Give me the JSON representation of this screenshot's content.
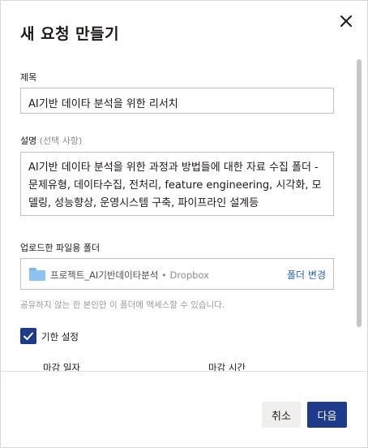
{
  "dialog": {
    "title": "새 요청 만들기",
    "close_icon": "close-icon"
  },
  "form": {
    "title_label": "제목",
    "title_value": "AI기반 데이타 분석을 위한 리서치",
    "description_label": "설명",
    "description_optional": "(선택 사항)",
    "description_value": "AI기반 데이타 분석을 위한 과정과 방법들에 대한 자료 수집 폴더 - 문제유형, 데이타수집, 전처리, feature engineering, 시각화, 모델링, 성능향상, 운영시스템 구축, 파이프라인 설계등",
    "folder_label": "업로드한 파일용 폴더",
    "folder_name": "프로젝트_AI기반데이타분석",
    "folder_source": " • Dropbox",
    "change_folder": "폴더 변경",
    "helper_text": "공유하지 않는 한 본인만 이 폴더에 액세스할 수 있습니다.",
    "deadline_checkbox_label": "기한 설정",
    "deadline_checked": true,
    "due_date_label": "마감 일자",
    "due_time_label": "마감 시간"
  },
  "footer": {
    "cancel_label": "취소",
    "next_label": "다음"
  },
  "colors": {
    "primary": "#1e3a8a",
    "link": "#2565b8",
    "folder": "#8ec2f2"
  }
}
